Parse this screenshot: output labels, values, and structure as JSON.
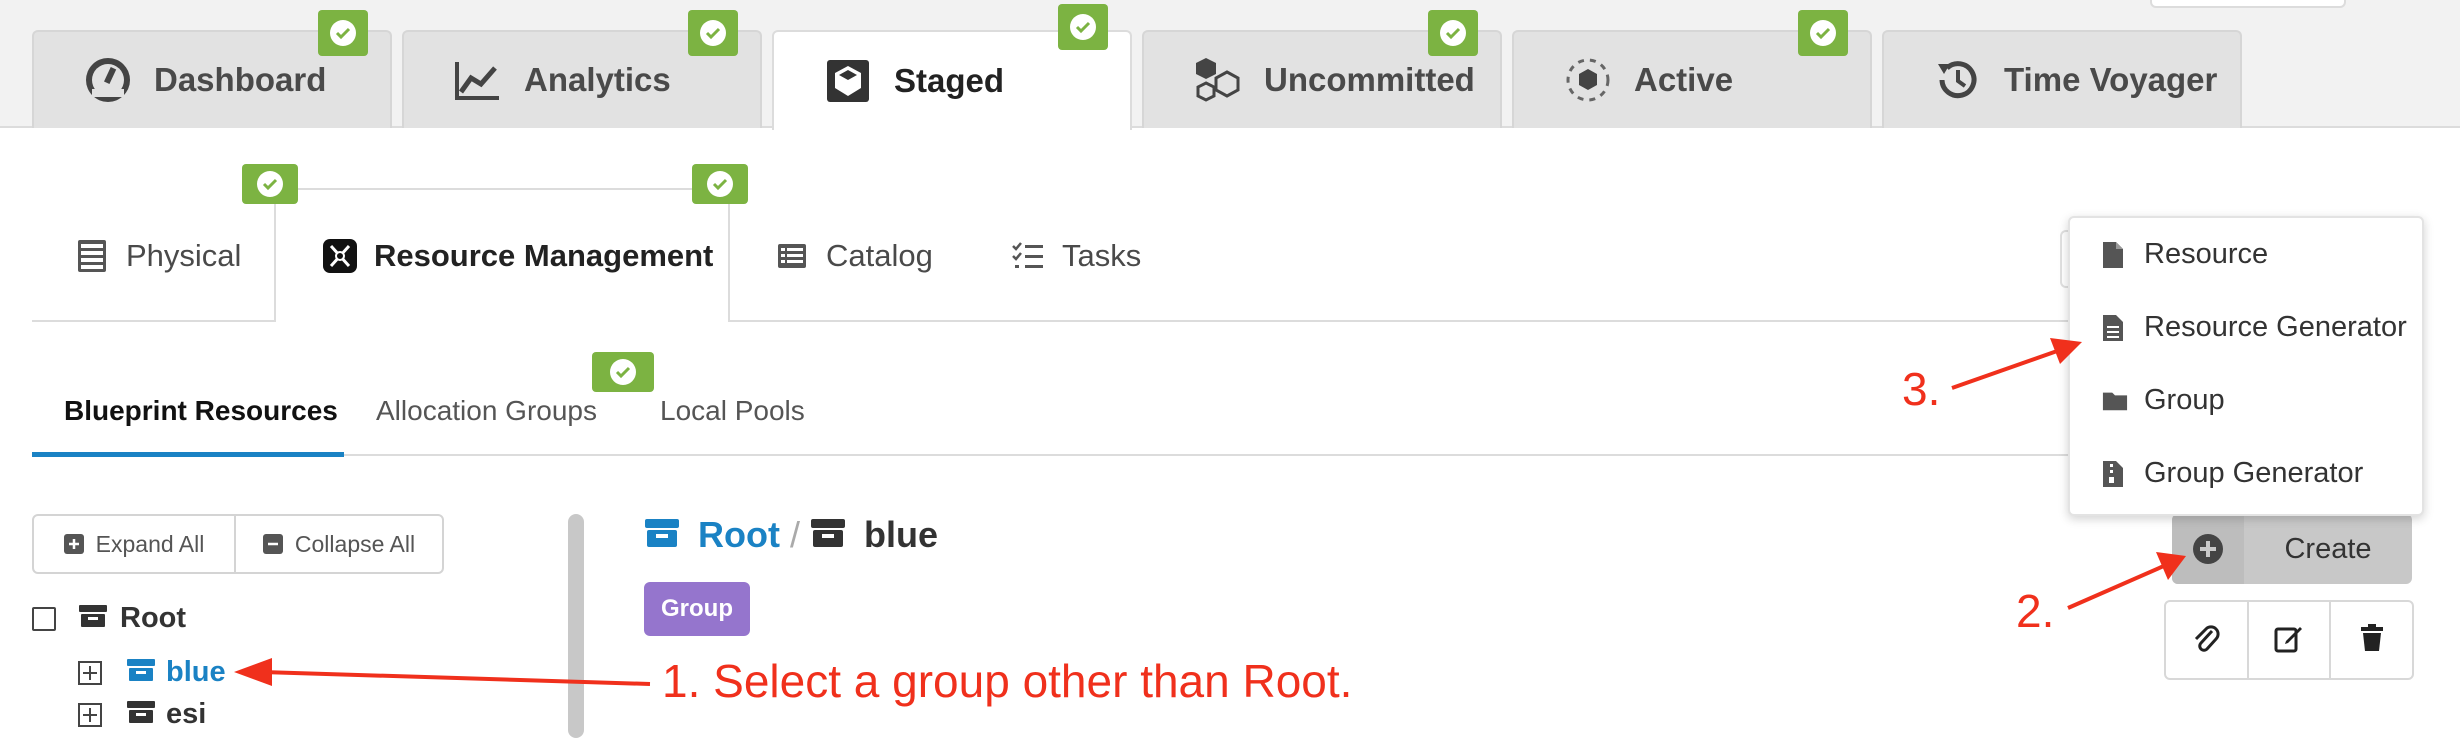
{
  "top_tabs": [
    {
      "label": "Dashboard",
      "icon": "dashboard-icon"
    },
    {
      "label": "Analytics",
      "icon": "analytics-icon"
    },
    {
      "label": "Staged",
      "icon": "staged-icon",
      "active": true
    },
    {
      "label": "Uncommitted",
      "icon": "uncommitted-icon"
    },
    {
      "label": "Active",
      "icon": "active-icon"
    },
    {
      "label": "Time Voyager",
      "icon": "history-icon"
    }
  ],
  "sub_tabs": [
    {
      "label": "Physical",
      "icon": "rack-icon"
    },
    {
      "label": "Resource Management",
      "icon": "resource-icon",
      "active": true
    },
    {
      "label": "Catalog",
      "icon": "list-icon"
    },
    {
      "label": "Tasks",
      "icon": "tasks-icon"
    }
  ],
  "resource_tabs": [
    {
      "label": "Blueprint Resources",
      "active": true
    },
    {
      "label": "Allocation Groups"
    },
    {
      "label": "Local Pools"
    }
  ],
  "tree_toolbar": {
    "expand_all": "Expand All",
    "collapse_all": "Collapse All"
  },
  "tree": {
    "root": "Root",
    "children": [
      {
        "label": "blue",
        "selected": true
      },
      {
        "label": "esi"
      }
    ]
  },
  "breadcrumb": {
    "root": "Root",
    "separator": "/",
    "current": "blue"
  },
  "type_badge": "Group",
  "create_button": "Create",
  "create_menu": [
    {
      "label": "Resource",
      "icon": "file-icon"
    },
    {
      "label": "Resource Generator",
      "icon": "file-text-icon"
    },
    {
      "label": "Group",
      "icon": "folder-icon"
    },
    {
      "label": "Group Generator",
      "icon": "file-archive-icon"
    }
  ],
  "annotations": {
    "step1": "1. Select a group other than Root.",
    "step2": "2.",
    "step3": "3."
  },
  "colors": {
    "accent_blue": "#1a82c4",
    "badge_green": "#7cb342",
    "group_purple": "#9575cd",
    "annotation_red": "#f0301c"
  }
}
